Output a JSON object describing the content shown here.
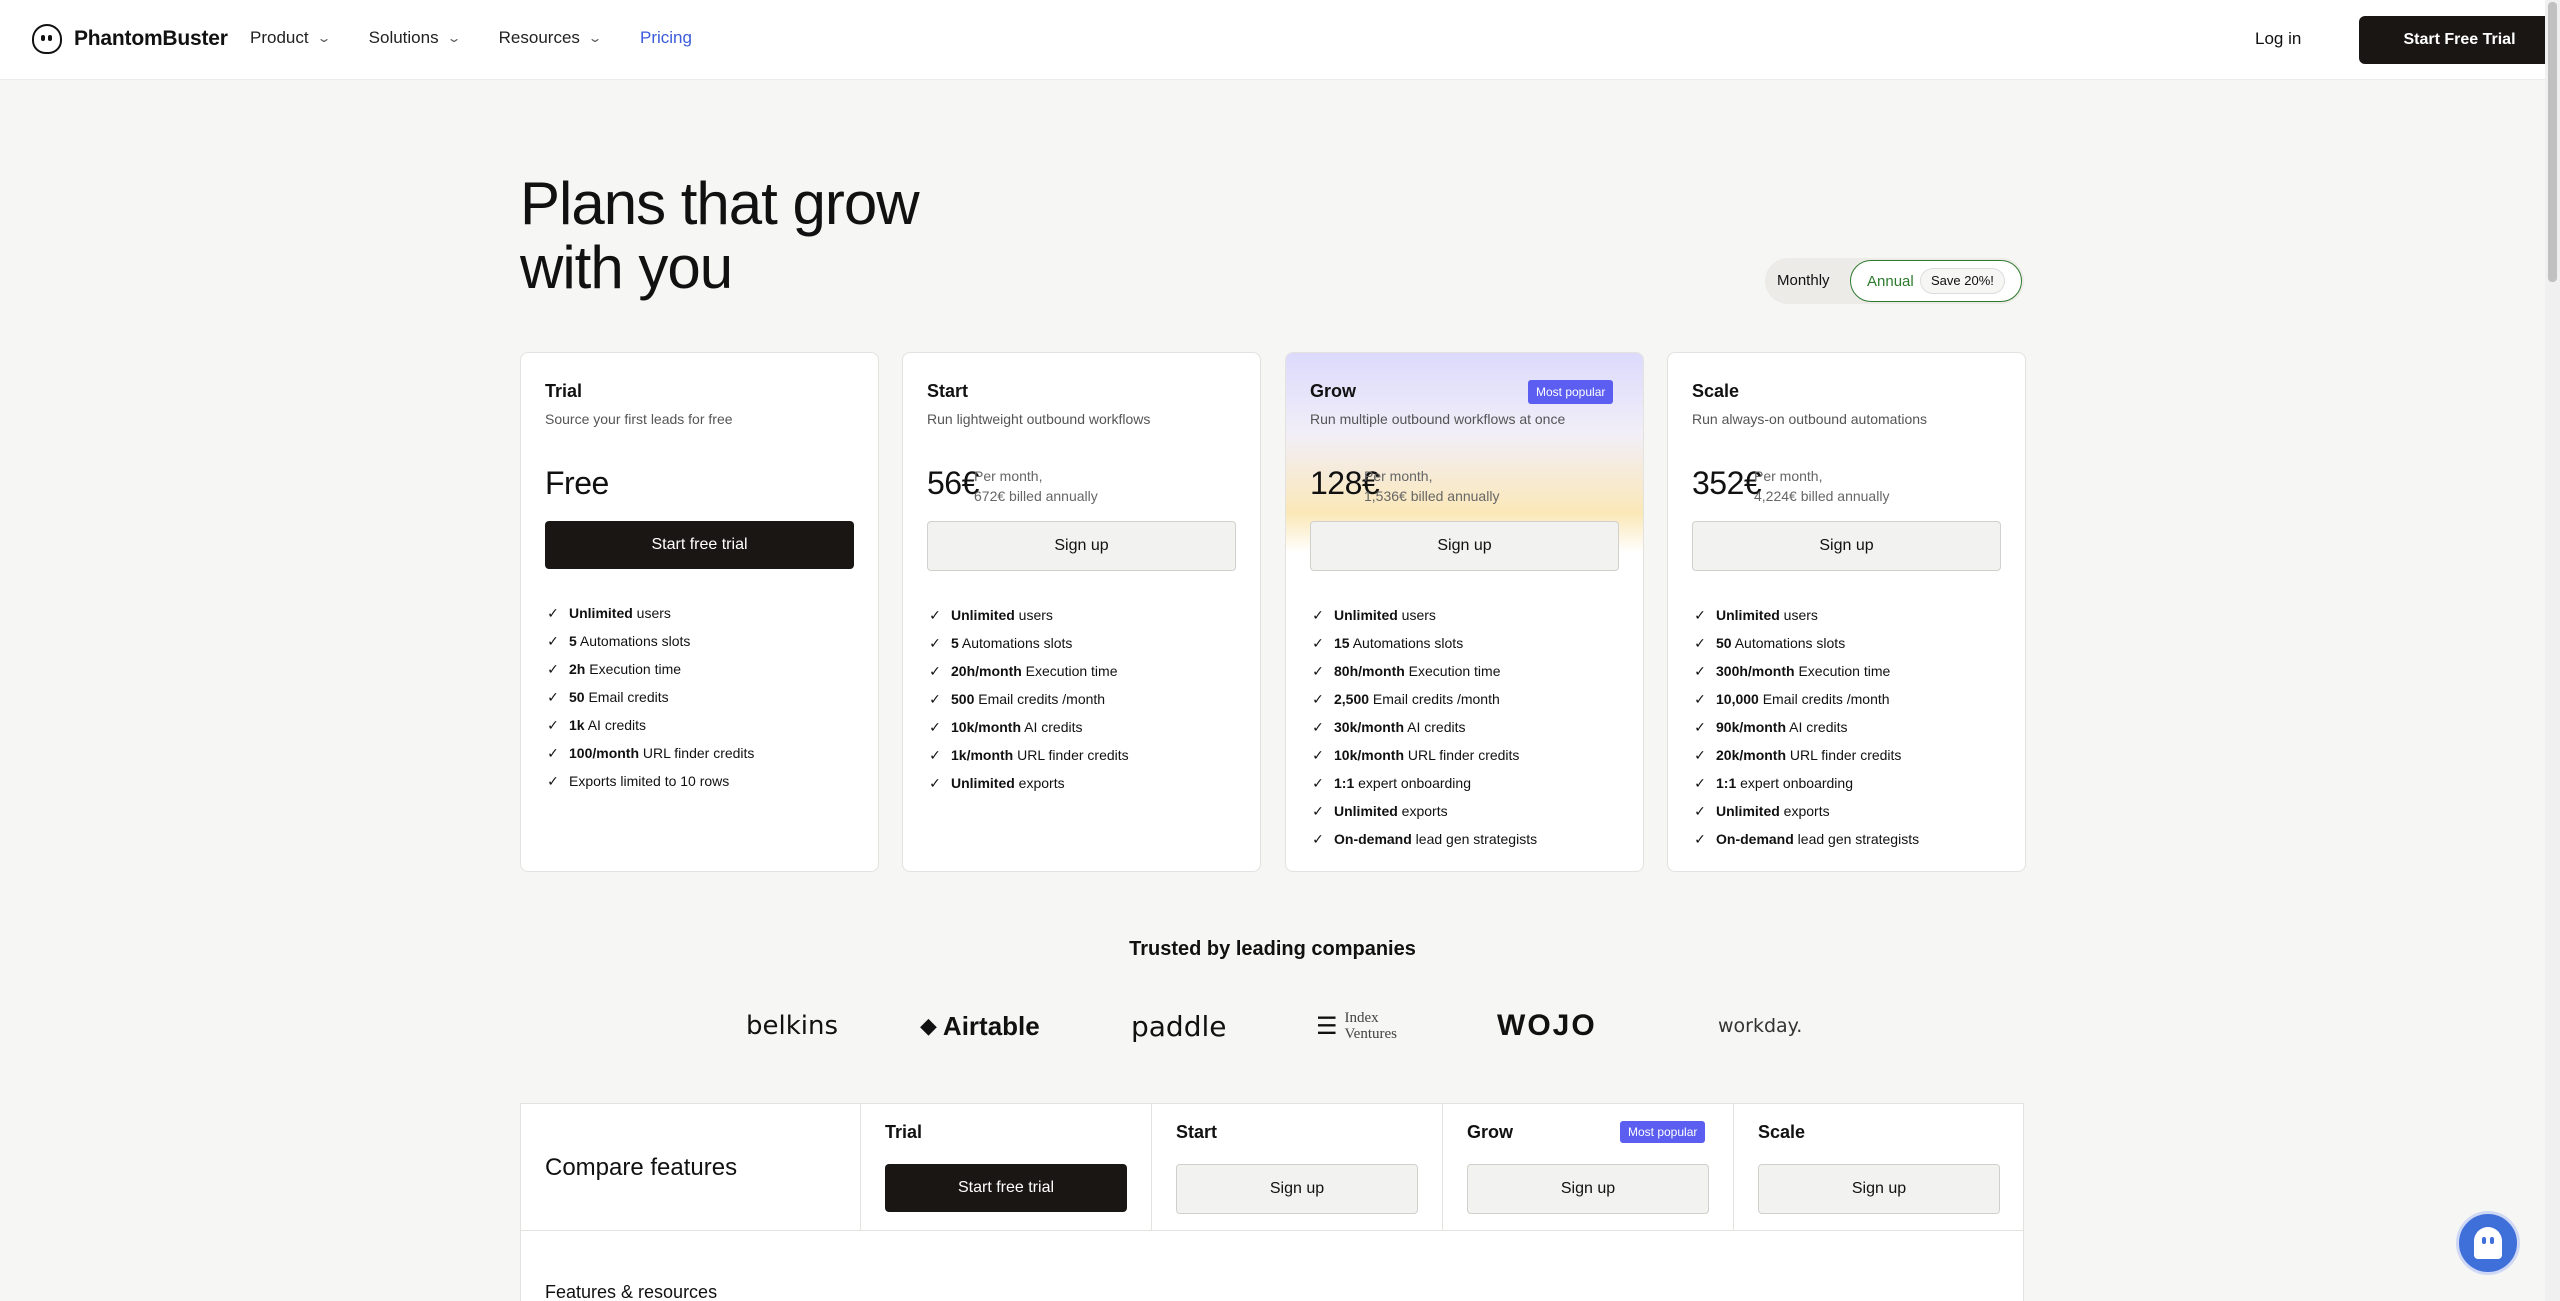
{
  "nav": {
    "brand": "PhantomBuster",
    "items": [
      {
        "label": "Product"
      },
      {
        "label": "Solutions"
      },
      {
        "label": "Resources"
      },
      {
        "label": "Pricing"
      }
    ],
    "login": "Log in",
    "cta": "Start Free Trial"
  },
  "hero": {
    "title_line1": "Plans that grow",
    "title_line2": "with you"
  },
  "billing_toggle": {
    "monthly": "Monthly",
    "annual": "Annual",
    "save": "Save 20%!",
    "selected": "Annual"
  },
  "plans": [
    {
      "name": "Trial",
      "subtitle": "Source your first leads for free",
      "price": "Free",
      "note1": "",
      "note2": "",
      "button": "Start free trial",
      "features": [
        {
          "b": "Unlimited",
          "t": " users"
        },
        {
          "b": "5",
          "t": " Automations slots"
        },
        {
          "b": "2h",
          "t": " Execution time"
        },
        {
          "b": "50",
          "t": " Email credits"
        },
        {
          "b": "1k",
          "t": " AI credits"
        },
        {
          "b": "100/month",
          "t": " URL finder credits"
        },
        {
          "b": "",
          "t": "Exports limited to 10 rows"
        }
      ]
    },
    {
      "name": "Start",
      "subtitle": "Run lightweight outbound workflows",
      "price": "56€",
      "note1": "Per month,",
      "note2": "672€ billed annually",
      "button": "Sign up",
      "features": [
        {
          "b": "Unlimited",
          "t": " users"
        },
        {
          "b": "5",
          "t": " Automations slots"
        },
        {
          "b": "20h/month",
          "t": " Execution time"
        },
        {
          "b": "500",
          "t": " Email credits /month"
        },
        {
          "b": "10k/month",
          "t": " AI credits"
        },
        {
          "b": "1k/month",
          "t": " URL finder credits"
        },
        {
          "b": "Unlimited",
          "t": " exports"
        }
      ]
    },
    {
      "name": "Grow",
      "badge": "Most popular",
      "subtitle": "Run multiple outbound workflows at once",
      "price": "128€",
      "note1": "Per month,",
      "note2": "1,536€ billed annually",
      "button": "Sign up",
      "features": [
        {
          "b": "Unlimited",
          "t": " users"
        },
        {
          "b": "15",
          "t": " Automations slots"
        },
        {
          "b": "80h/month",
          "t": " Execution time"
        },
        {
          "b": "2,500",
          "t": " Email credits /month"
        },
        {
          "b": "30k/month",
          "t": " AI credits"
        },
        {
          "b": "10k/month",
          "t": " URL finder credits"
        },
        {
          "b": "1:1",
          "t": " expert onboarding"
        },
        {
          "b": "Unlimited",
          "t": " exports"
        },
        {
          "b": "On-demand",
          "t": " lead gen strategists"
        }
      ]
    },
    {
      "name": "Scale",
      "subtitle": "Run always-on outbound automations",
      "price": "352€",
      "note1": "Per month,",
      "note2": "4,224€ billed annually",
      "button": "Sign up",
      "features": [
        {
          "b": "Unlimited",
          "t": " users"
        },
        {
          "b": "50",
          "t": " Automations slots"
        },
        {
          "b": "300h/month",
          "t": " Execution time"
        },
        {
          "b": "10,000",
          "t": " Email credits /month"
        },
        {
          "b": "90k/month",
          "t": " AI credits"
        },
        {
          "b": "20k/month",
          "t": " URL finder credits"
        },
        {
          "b": "1:1",
          "t": " expert onboarding"
        },
        {
          "b": "Unlimited",
          "t": " exports"
        },
        {
          "b": "On-demand",
          "t": " lead gen strategists"
        }
      ]
    }
  ],
  "trusted": {
    "title": "Trusted by leading companies",
    "logos": [
      "belkins",
      "Airtable",
      "paddle",
      "Index Ventures",
      "WOJO",
      "workday."
    ]
  },
  "compare": {
    "title": "Compare features",
    "columns": [
      {
        "name": "Trial",
        "button": "Start free trial"
      },
      {
        "name": "Start",
        "button": "Sign up"
      },
      {
        "name": "Grow",
        "button": "Sign up",
        "badge": "Most popular"
      },
      {
        "name": "Scale",
        "button": "Sign up"
      }
    ],
    "section": "Features & resources"
  },
  "colors": {
    "accent_blue": "#3b5bdb",
    "badge_purple": "#5b5ef0",
    "dark_button": "#1a1614",
    "annual_green": "#2d7a2d",
    "page_bg": "#f6f6f4"
  },
  "icons": [
    "phantombuster-logo-icon",
    "chevron-down-icon",
    "check-icon",
    "chat-ghost-icon"
  ]
}
